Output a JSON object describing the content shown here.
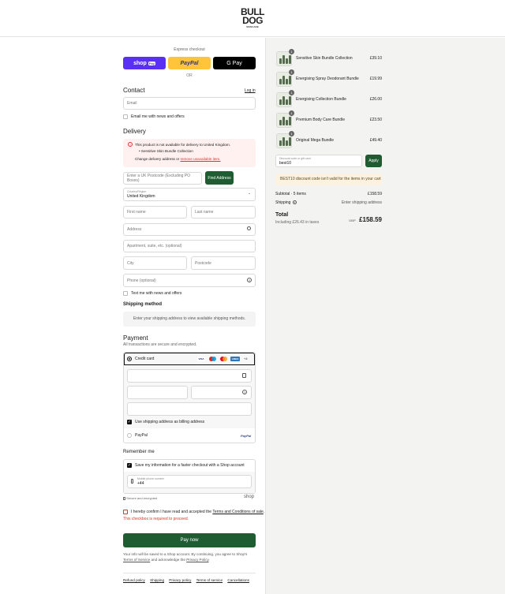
{
  "brand": {
    "line1": "BULL",
    "line2": "DOG",
    "line3": "SKINCARE"
  },
  "express": {
    "label": "Express checkout",
    "shop": "shop",
    "shop_pay": "Pay",
    "paypal": "PayPal",
    "gpay": "G Pay",
    "or": "OR"
  },
  "contact": {
    "heading": "Contact",
    "login": "Log in",
    "email_placeholder": "Email",
    "news_label": "Email me with news and offers"
  },
  "delivery": {
    "heading": "Delivery",
    "error_title": "This product is not available for delivery to United Kingdom.",
    "error_item": "Sensitive Skin Bundle Collection",
    "error_text_before": "Change delivery address or",
    "error_link": "remove unavailable item.",
    "postcode_placeholder": "Enter a UK Postcode (Excluding PO Boxes)",
    "find_address": "Find Address",
    "country_label": "Country/Region",
    "country_value": "United Kingdom",
    "first_name": "First name",
    "last_name": "Last name",
    "address": "Address",
    "apartment": "Apartment, suite, etc. (optional)",
    "city": "City",
    "postcode": "Postcode",
    "phone": "Phone (optional)",
    "text_news": "Text me with news and offers"
  },
  "shipping": {
    "heading": "Shipping method",
    "placeholder": "Enter your shipping address to view available shipping methods."
  },
  "payment": {
    "heading": "Payment",
    "subtitle": "All transactions are secure and encrypted.",
    "credit_card": "Credit card",
    "brands": [
      "VISA",
      "",
      "",
      "AMEX"
    ],
    "more": "+4",
    "billing_label": "Use shipping address as billing address",
    "paypal": "PayPal",
    "paypal_logo": "PayPal"
  },
  "remember": {
    "heading": "Remember me",
    "save_label": "Save my information for a faster checkout with a Shop account",
    "mobile_label": "Mobile phone number",
    "mobile_value": "+44",
    "secure": "Secure and encrypted",
    "shop": "shop"
  },
  "terms": {
    "before": "I hereby confirm I have read and accepted the",
    "link": "Terms and Conditions of sale",
    "after": ".",
    "error": "This checkbox is required to proceed."
  },
  "pay_now": "Pay now",
  "fineprint": {
    "line1": "Your info will be saved to a Shop account. By continuing, you agree to Shop's",
    "tos": "Terms of Service",
    "mid": "and acknowledge the",
    "privacy": "Privacy Policy",
    "end": "."
  },
  "footer_links": [
    "Refund policy",
    "Shipping",
    "Privacy policy",
    "Terms of service",
    "Cancellations"
  ],
  "cart": {
    "items": [
      {
        "name": "Sensitive Skin Bundle Collection",
        "qty": "1",
        "price": "£39.10"
      },
      {
        "name": "Energising Spray Deodorant Bundle",
        "qty": "1",
        "price": "£19.99"
      },
      {
        "name": "Energising Collection Bundle",
        "qty": "1",
        "price": "£26.00"
      },
      {
        "name": "Premium Body Care Bundle",
        "qty": "1",
        "price": "£23.50"
      },
      {
        "name": "Original Mega Bundle",
        "qty": "1",
        "price": "£49.40"
      }
    ],
    "discount_label": "Discount code or gift card",
    "discount_value": "best10",
    "apply": "Apply",
    "discount_warning": "BEST10 discount code isn't valid for the items in your cart",
    "subtotal_label": "Subtotal · 5 items",
    "subtotal_value": "£158.59",
    "shipping_label": "Shipping",
    "shipping_value": "Enter shipping address",
    "total_label": "Total",
    "currency": "GBP",
    "total_value": "£158.59",
    "taxes": "Including £26.43 in taxes"
  },
  "colors": {
    "accent_green": "#1f5c32",
    "shop_purple": "#5a31f4",
    "paypal_yellow": "#ffc439",
    "error_red": "#d9342b",
    "error_bg": "#fff1f0",
    "warning_bg": "#fdf2e0"
  }
}
